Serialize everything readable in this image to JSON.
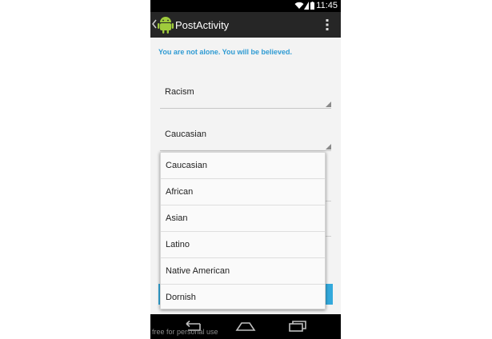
{
  "status_bar": {
    "time": "11:45"
  },
  "action_bar": {
    "title": "PostActivity"
  },
  "content": {
    "tagline": "You are not alone. You will be believed.",
    "spinner_category": {
      "value": "Racism"
    },
    "spinner_ethnicity": {
      "value": "Caucasian"
    }
  },
  "dropdown": {
    "options": [
      "Caucasian",
      "African",
      "Asian",
      "Latino",
      "Native American",
      "Dornish"
    ]
  },
  "watermark": "free for personal use",
  "colors": {
    "accent": "#2f9bd3",
    "button": "#33a9dc",
    "actionbar": "#262626"
  }
}
